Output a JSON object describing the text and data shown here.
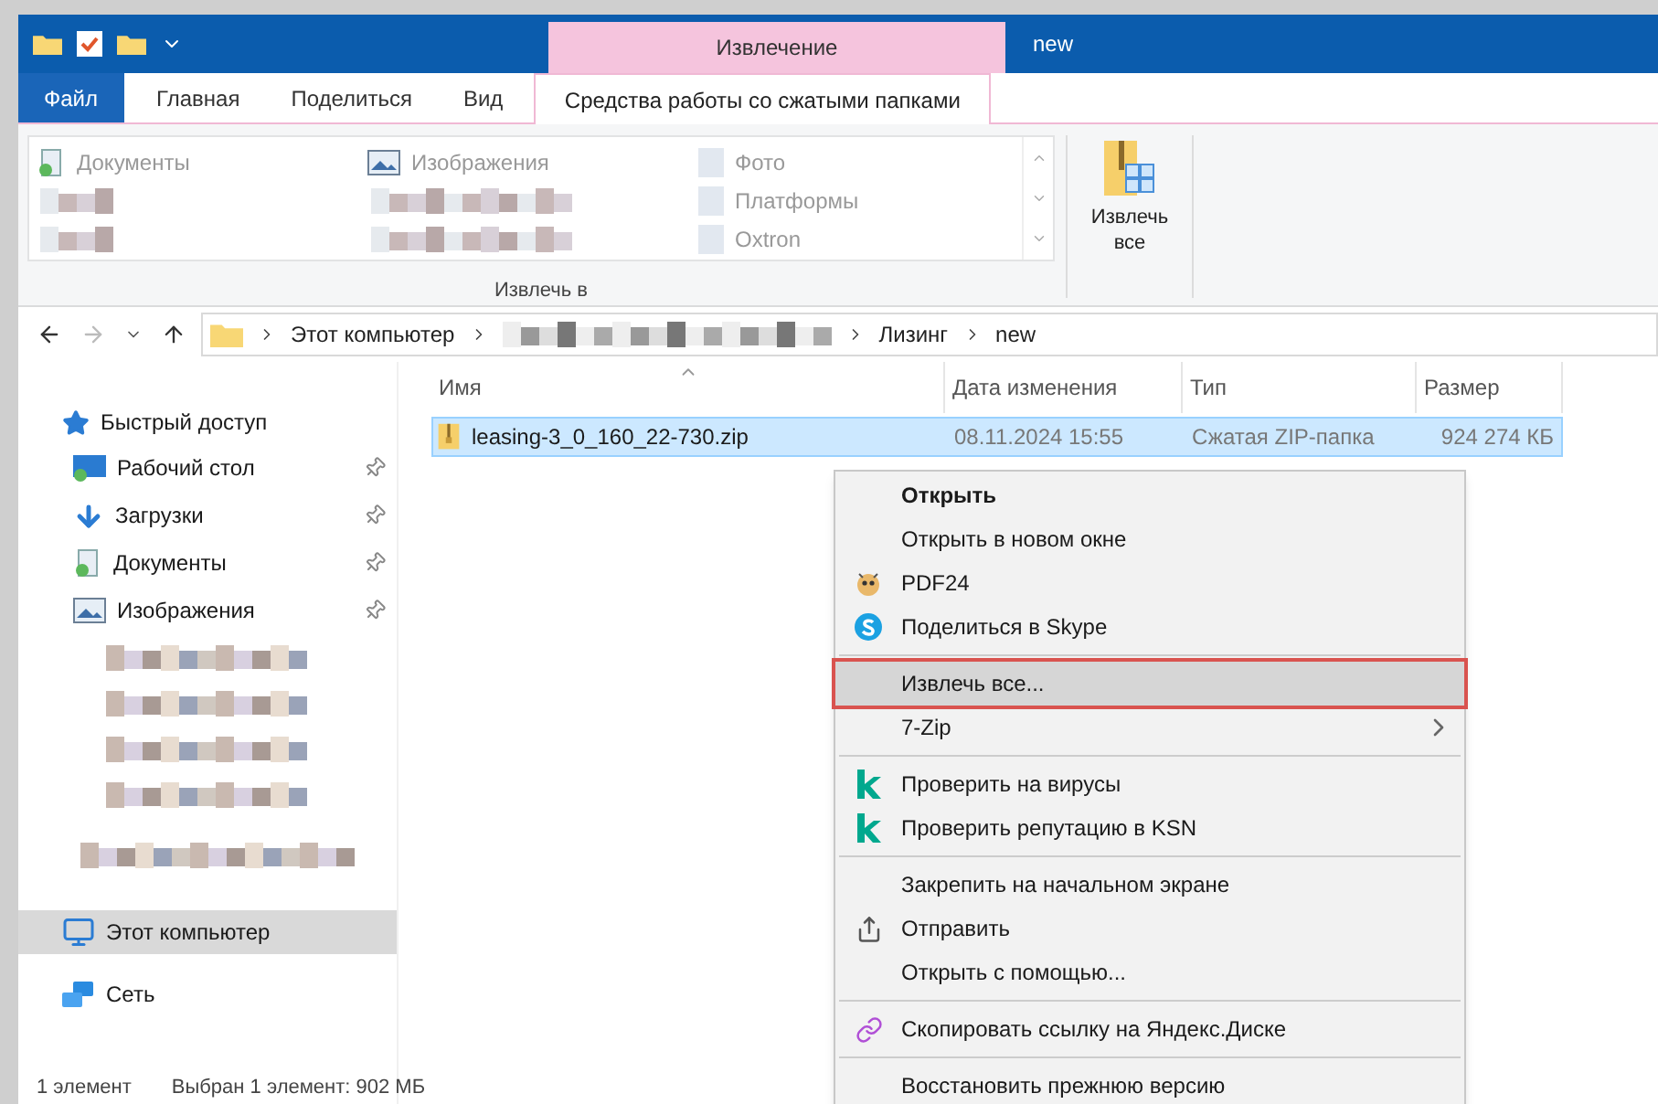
{
  "title_bar": {
    "contextual_tab": "Извлечение",
    "title": "new"
  },
  "ribbon_tabs": [
    {
      "label": "Файл",
      "kind": "file",
      "selected": false
    },
    {
      "label": "Главная",
      "kind": "tab",
      "selected": false
    },
    {
      "label": "Поделиться",
      "kind": "tab",
      "selected": false
    },
    {
      "label": "Вид",
      "kind": "tab",
      "selected": false
    },
    {
      "label": "Средства работы со сжатыми папками",
      "kind": "contextual",
      "selected": true
    }
  ],
  "ribbon": {
    "destinations": [
      [
        {
          "kind": "documents",
          "label": "Документы"
        },
        {
          "kind": "blurred"
        },
        {
          "kind": "blurred"
        }
      ],
      [
        {
          "kind": "pictures",
          "label": "Изображения"
        },
        {
          "kind": "blurred"
        },
        {
          "kind": "blurred"
        }
      ],
      [
        {
          "kind": "folder",
          "label": "Фото"
        },
        {
          "kind": "folder",
          "label": "Платформы"
        },
        {
          "kind": "folder",
          "label": "Oxtron"
        }
      ]
    ],
    "group_label": "Извлечь в",
    "extract_all": "Извлечь все"
  },
  "address": {
    "segments": [
      {
        "kind": "text",
        "label": "Этот компьютер"
      },
      {
        "kind": "blurred"
      },
      {
        "kind": "text",
        "label": "Лизинг"
      },
      {
        "kind": "text",
        "label": "new"
      }
    ]
  },
  "columns": [
    "Имя",
    "Дата изменения",
    "Тип",
    "Размер"
  ],
  "files": [
    {
      "name": "leasing-3_0_160_22-730.zip",
      "date": "08.11.2024 15:55",
      "type": "Сжатая ZIP-папка",
      "size": "924 274 КБ",
      "selected": true
    }
  ],
  "nav": [
    {
      "kind": "quick",
      "label": "Быстрый доступ",
      "selected": false,
      "children": [
        {
          "kind": "desktop",
          "label": "Рабочий стол",
          "pinned": true,
          "selected": false
        },
        {
          "kind": "downloads",
          "label": "Загрузки",
          "pinned": true,
          "selected": false
        },
        {
          "kind": "documents",
          "label": "Документы",
          "pinned": true,
          "selected": false
        },
        {
          "kind": "pictures",
          "label": "Изображения",
          "pinned": true,
          "selected": false
        },
        {
          "kind": "blurred"
        },
        {
          "kind": "blurred"
        },
        {
          "kind": "blurred"
        },
        {
          "kind": "blurred"
        }
      ]
    },
    {
      "kind": "blurred"
    },
    {
      "kind": "computer",
      "label": "Этот компьютер",
      "selected": true
    },
    {
      "kind": "network",
      "label": "Сеть",
      "selected": false
    }
  ],
  "context_menu": [
    [
      {
        "label": "Открыть",
        "bold": true,
        "selected": false
      },
      {
        "label": "Открыть в новом окне",
        "bold": false,
        "selected": false
      },
      {
        "label": "PDF24",
        "kind": "mascot",
        "bold": false,
        "selected": false
      },
      {
        "label": "Поделиться в Skype",
        "kind": "chat",
        "bold": false,
        "selected": false
      }
    ],
    [
      {
        "label": "Извлечь все...",
        "bold": false,
        "selected": true
      },
      {
        "label": "7-Zip",
        "submenu": true,
        "bold": false,
        "selected": false
      }
    ],
    [
      {
        "label": "Проверить на вирусы",
        "kind": "k",
        "bold": false,
        "selected": false
      },
      {
        "label": "Проверить репутацию в KSN",
        "kind": "k",
        "bold": false,
        "selected": false
      }
    ],
    [
      {
        "label": "Закрепить на начальном экране",
        "bold": false,
        "selected": false
      },
      {
        "label": "Отправить",
        "kind": "share",
        "bold": false,
        "selected": false
      },
      {
        "label": "Открыть с помощью...",
        "bold": false,
        "selected": false
      }
    ],
    [
      {
        "label": "Скопировать ссылку на Яндекс.Диске",
        "kind": "link",
        "bold": false,
        "selected": false
      }
    ],
    [
      {
        "label": "Восстановить прежнюю версию",
        "bold": false,
        "selected": false
      }
    ]
  ],
  "status_bar": [
    "1 элемент",
    "Выбран 1 элемент: 902 МБ"
  ]
}
